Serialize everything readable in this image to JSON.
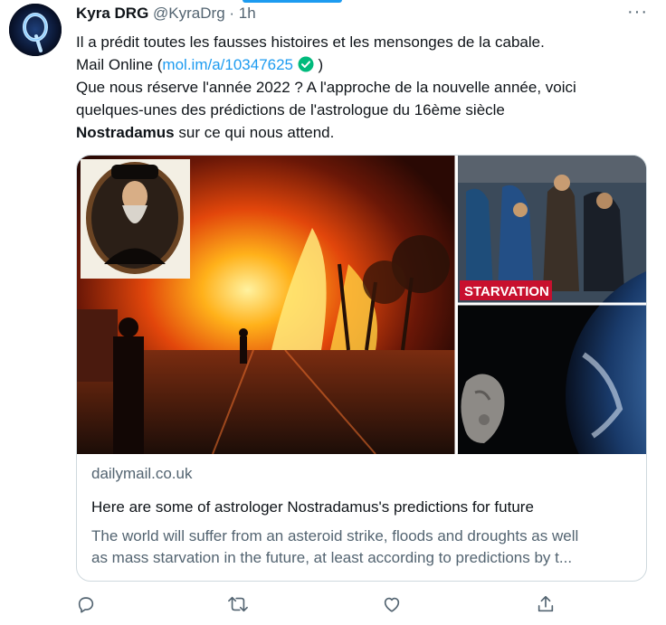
{
  "tweet": {
    "author_name": "Kyra DRG",
    "handle": "@KyraDrg",
    "separator": "·",
    "time": "1h",
    "more": "···",
    "line1": "Il a prédit toutes les fausses histoires et les mensonges de la cabale.",
    "line2_prefix": "Mail Online (",
    "line2_link": "mol.im/a/10347625",
    "line2_suffix": ")",
    "line3": "Que nous réserve l'année 2022 ? A l'approche de la nouvelle année, voici",
    "line4": "quelques-unes des prédictions de l'astrologue du 16ème siècle",
    "line5_bold": "Nostradamus",
    "line5_rest": " sur ce qui nous attend."
  },
  "card": {
    "image_label": "STARVATION",
    "domain": "dailymail.co.uk",
    "title": "Here are some of astrologer Nostradamus's predictions for future",
    "description_line1": "The world will suffer from an asteroid strike, floods and droughts as well",
    "description_line2": "as mass starvation in the future, at least according to predictions by t..."
  },
  "icons": {
    "reply": "reply-icon",
    "retweet": "retweet-icon",
    "like": "heart-icon",
    "share": "share-icon",
    "verified": "verified-check-icon"
  },
  "colors": {
    "link": "#1d9bf0",
    "verified": "#00ba7c",
    "muted": "#536471",
    "starvation_red": "#c8102e"
  }
}
